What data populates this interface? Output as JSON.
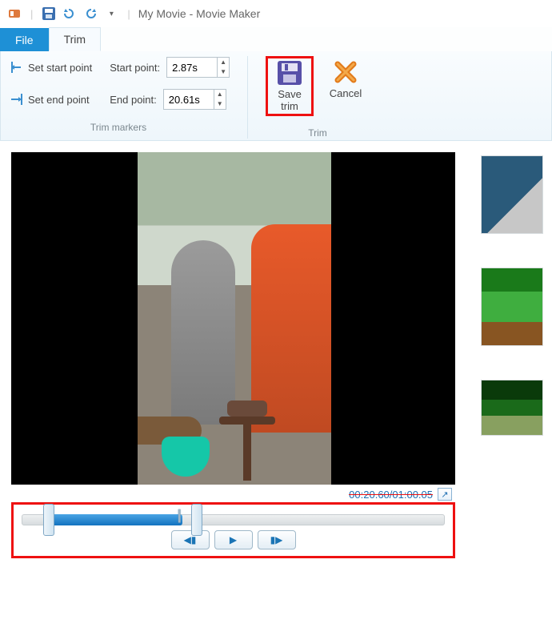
{
  "window": {
    "title": "My Movie - Movie Maker"
  },
  "tabs": {
    "file": "File",
    "trim": "Trim"
  },
  "trim_markers_group": {
    "set_start": "Set start point",
    "set_end": "Set end point",
    "start_label": "Start point:",
    "end_label": "End point:",
    "start_value": "2.87s",
    "end_value": "20.61s",
    "label": "Trim markers"
  },
  "trim_group": {
    "save_line1": "Save",
    "save_line2": "trim",
    "cancel": "Cancel",
    "label": "Trim"
  },
  "preview": {
    "timecode": "00:20.60/01:00.05"
  },
  "slider": {
    "start_pct": 6,
    "end_pct": 40,
    "playhead_pct": 38
  },
  "icons": {
    "app": "app-icon",
    "save_qat": "save-icon",
    "undo": "undo-icon",
    "redo": "redo-icon",
    "dropdown": "▾"
  }
}
